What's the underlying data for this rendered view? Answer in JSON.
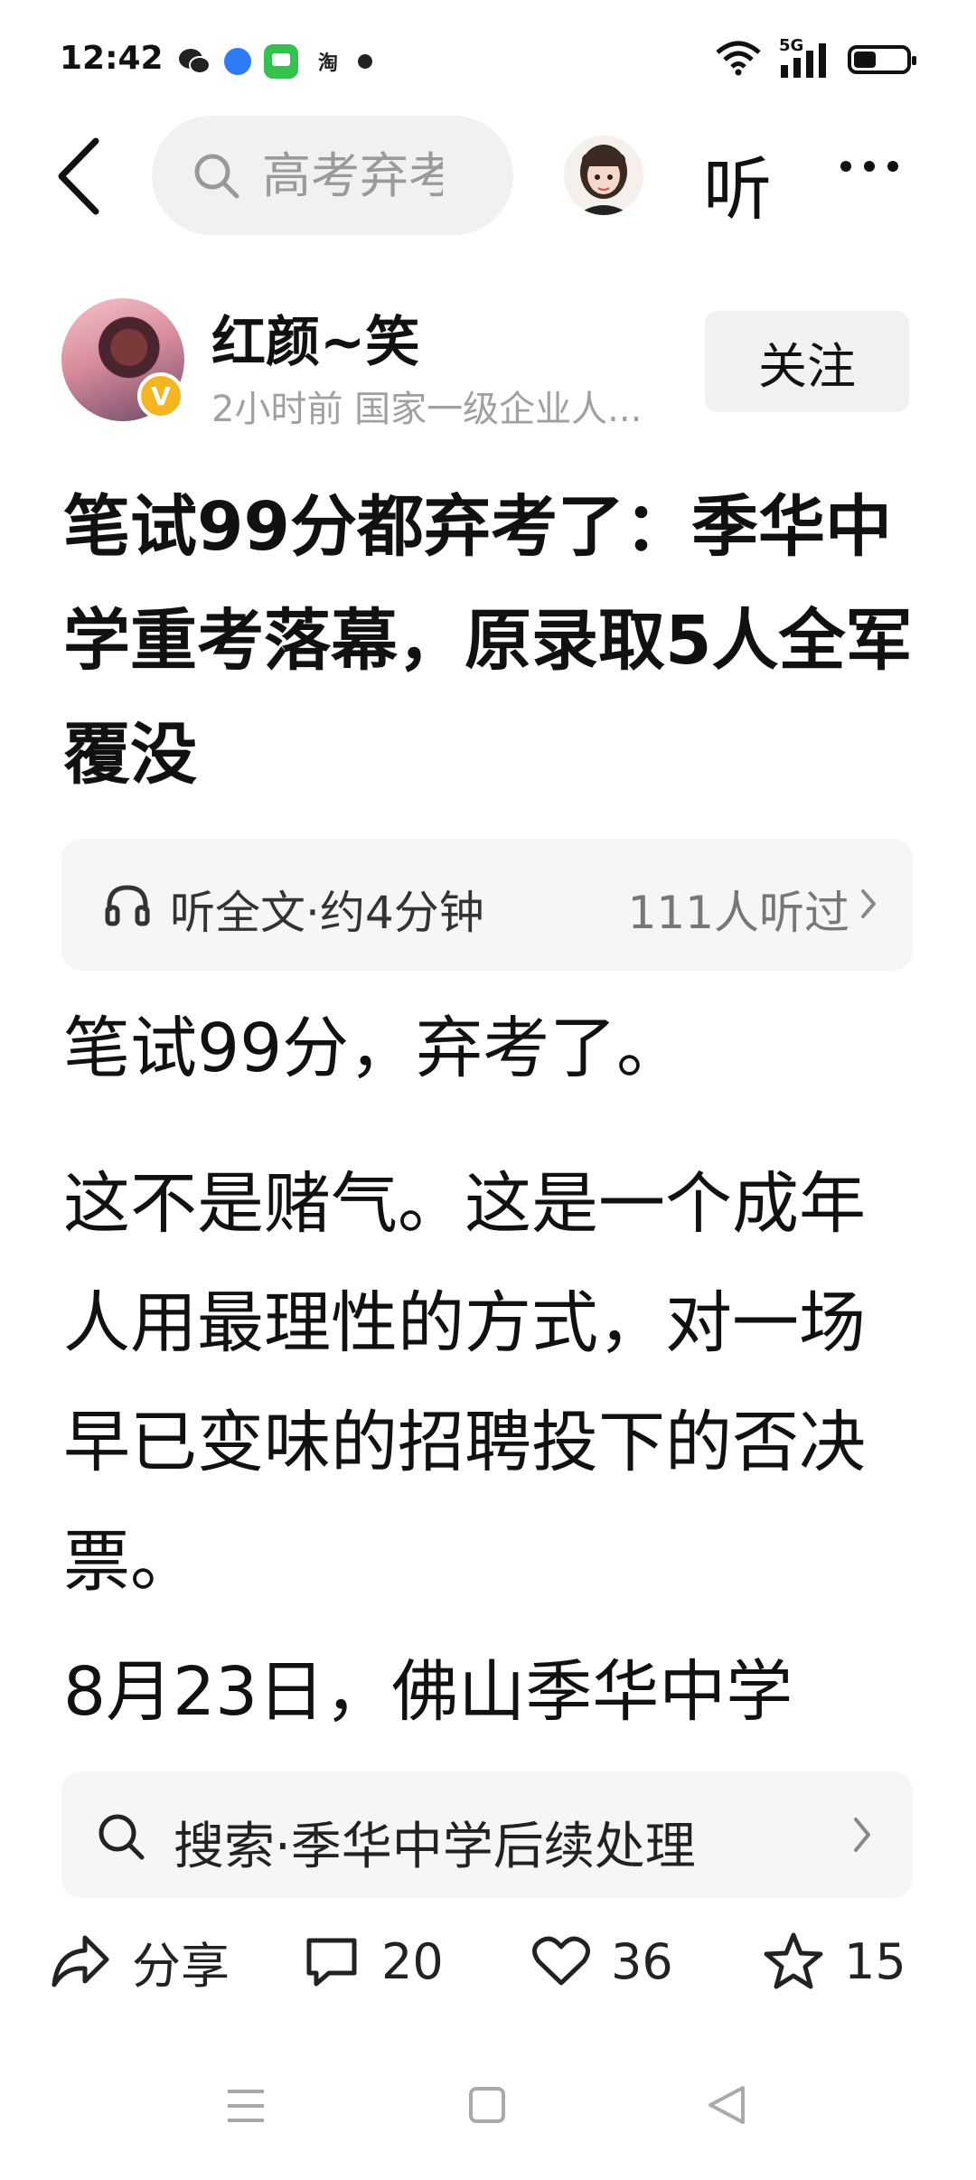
{
  "status_bar": {
    "time": "12:42",
    "app_icons": [
      "wechat-icon",
      "browser-icon",
      "messages-icon",
      "taobao-icon",
      "notification-dot-icon"
    ],
    "taobao_glyph": "淘",
    "network": "5G"
  },
  "top_bar": {
    "search_placeholder": "高考弃考",
    "listen_label": "听"
  },
  "author": {
    "name": "红颜~笑",
    "meta": "2小时前  国家一级企业人...",
    "verified_badge": "V",
    "follow_label": "关注"
  },
  "article": {
    "title": "笔试99分都弃考了：季华中学重考落幕，原录取5人全军覆没",
    "listen_bar": {
      "label": "听全文·约4分钟",
      "count": "111人听过"
    },
    "paragraphs": [
      "笔试99分，弃考了。",
      "这不是赌气。这是一个成年人用最理性的方式，对一场早已变味的招聘投下的否决票。",
      "8月23日，佛山季华中学"
    ]
  },
  "related_search": {
    "text": "搜索·季华中学后续处理"
  },
  "actions": {
    "share_label": "分享",
    "comments": "20",
    "likes": "36",
    "favorites": "15"
  },
  "colors": {
    "background": "#ffffff",
    "chip_bg": "#f6f6f6",
    "meta_text": "#a0a0a0",
    "verified": "#f5b520"
  }
}
